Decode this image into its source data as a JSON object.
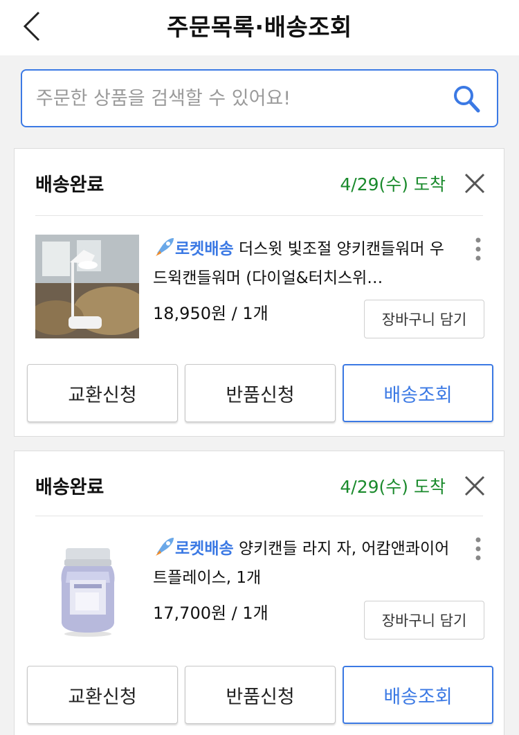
{
  "header": {
    "title": "주문목록·배송조회"
  },
  "search": {
    "placeholder": "주문한 상품을 검색할 수 있어요!"
  },
  "orders": [
    {
      "status": "배송완료",
      "arrival": "4/29(수) 도착",
      "rocket_label": "로켓배송",
      "product_name": "더스윗 빛조절 양키캔들워머 우드윅캔들워머 (다이얼&터치스위…",
      "price": "18,950원 / 1개",
      "cart_label": "장바구니 담기",
      "actions": [
        "교환신청",
        "반품신청",
        "배송조회"
      ]
    },
    {
      "status": "배송완료",
      "arrival": "4/29(수) 도착",
      "rocket_label": "로켓배송",
      "product_name": "양키캔들 라지 자, 어캄앤콰이어트플레이스, 1개",
      "price": "17,700원 / 1개",
      "cart_label": "장바구니 담기",
      "actions": [
        "교환신청",
        "반품신청",
        "배송조회"
      ]
    }
  ],
  "colors": {
    "accent": "#3b79e4",
    "arrival_green": "#1a8a2c"
  },
  "icons": [
    "back-arrow-icon",
    "search-icon",
    "close-icon",
    "rocket-icon",
    "more-vertical-icon"
  ]
}
